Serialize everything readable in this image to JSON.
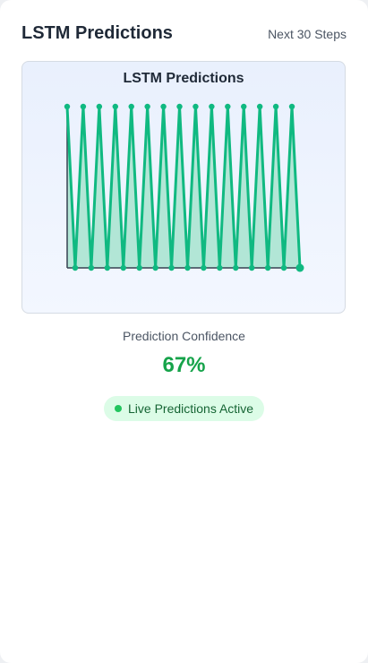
{
  "header": {
    "title": "LSTM Predictions",
    "subtitle": "Next 30 Steps"
  },
  "chart_data": {
    "type": "area",
    "title": "LSTM Predictions",
    "xlabel": "",
    "ylabel": "",
    "x": [
      0,
      1,
      2,
      3,
      4,
      5,
      6,
      7,
      8,
      9,
      10,
      11,
      12,
      13,
      14,
      15,
      16,
      17,
      18,
      19,
      20,
      21,
      22,
      23,
      24,
      25,
      26,
      27,
      28,
      29
    ],
    "values": [
      1,
      0,
      1,
      0,
      1,
      0,
      1,
      0,
      1,
      0,
      1,
      0,
      1,
      0,
      1,
      0,
      1,
      0,
      1,
      0,
      1,
      0,
      1,
      0,
      1,
      0,
      1,
      0,
      1,
      0
    ],
    "ylim": [
      0,
      1
    ],
    "grid": false,
    "colors": {
      "line": "#10b981",
      "fill": "#a7e3cf",
      "axis": "#374151"
    }
  },
  "confidence": {
    "label": "Prediction Confidence",
    "value": "67%"
  },
  "status": {
    "label": "Live Predictions Active",
    "color": "#22c55e"
  }
}
